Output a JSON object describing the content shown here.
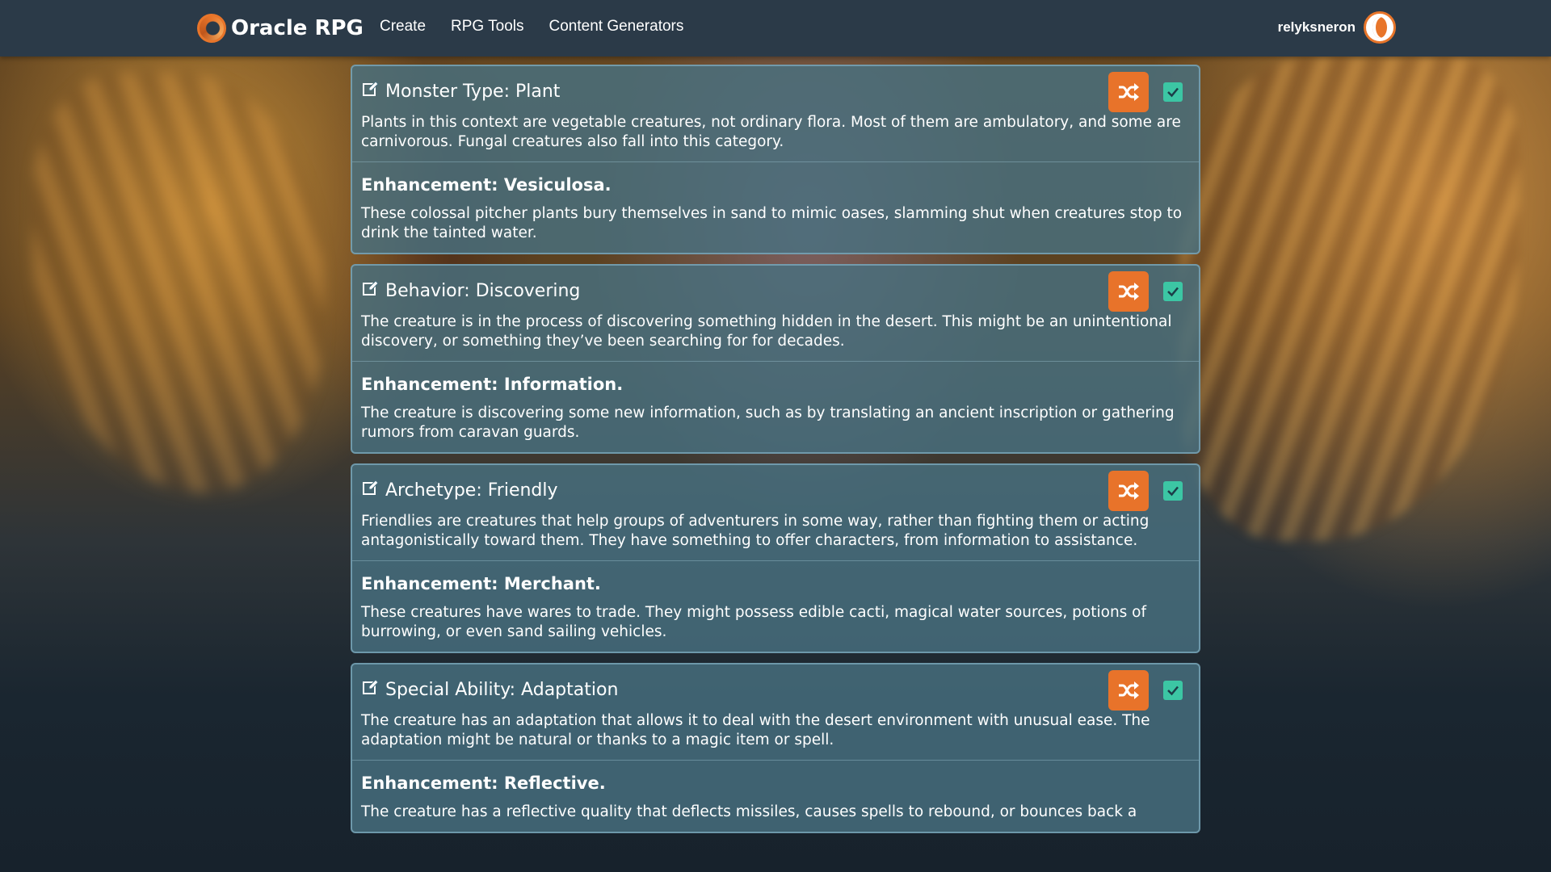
{
  "brand": {
    "name": "Oracle RPG"
  },
  "nav": {
    "items": [
      "Create",
      "RPG Tools",
      "Content Generators"
    ]
  },
  "user": {
    "name": "relyksneron"
  },
  "colors": {
    "accent": "#e8732a",
    "check": "#3cc6a4",
    "navbar": "#2b3a48",
    "card": "#487080"
  },
  "cards": [
    {
      "title": "Monster Type: Plant",
      "text": "Plants in this context are vegetable creatures, not ordinary flora. Most of them are ambulatory, and some are carnivorous. Fungal creatures also fall into this category.",
      "enhancement_title": "Enhancement: Vesiculosa.",
      "enhancement_text": "These colossal pitcher plants bury themselves in sand to mimic oases, slamming shut when creatures stop to drink the tainted water.",
      "checked": true
    },
    {
      "title": "Behavior: Discovering",
      "text": "The creature is in the process of discovering something hidden in the desert. This might be an unintentional discovery, or something they’ve been searching for for decades.",
      "enhancement_title": "Enhancement: Information.",
      "enhancement_text": "The creature is discovering some new information, such as by translating an ancient inscription or gathering rumors from caravan guards.",
      "checked": true
    },
    {
      "title": "Archetype: Friendly",
      "text": "Friendlies are creatures that help groups of adventurers in some way, rather than fighting them or acting antagonistically toward them. They have something to offer characters, from information to assistance.",
      "enhancement_title": "Enhancement: Merchant.",
      "enhancement_text": "These creatures have wares to trade. They might possess edible cacti, magical water sources, potions of burrowing, or even sand sailing vehicles.",
      "checked": true
    },
    {
      "title": "Special Ability: Adaptation",
      "text": "The creature has an adaptation that allows it to deal with the desert environment with unusual ease. The adaptation might be natural or thanks to a magic item or spell.",
      "enhancement_title": "Enhancement: Reflective.",
      "enhancement_text": "The creature has a reflective quality that deflects missiles, causes spells to rebound, or bounces back a",
      "checked": true
    }
  ]
}
